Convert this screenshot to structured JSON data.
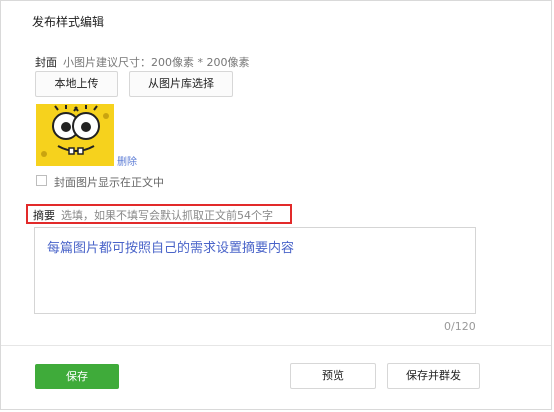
{
  "header": {
    "title": "发布样式编辑"
  },
  "cover": {
    "label": "封面",
    "hint": "小图片建议尺寸：200像素 * 200像素",
    "upload_local_label": "本地上传",
    "choose_from_library_label": "从图片库选择",
    "delete_label": "删除",
    "show_in_body_label": "封面图片显示在正文中",
    "show_in_body_checked": false
  },
  "summary": {
    "label": "摘要",
    "hint": "选填，如果不填写会默认抓取正文前54个字",
    "value": "每篇图片都可按照自己的需求设置摘要内容",
    "counter": "0/120"
  },
  "footer": {
    "save_label": "保存",
    "preview_label": "预览",
    "save_and_send_label": "保存并群发"
  },
  "colors": {
    "primary_green": "#3fab3a",
    "highlight_red": "#e22a2a",
    "link_blue": "#5b7bd5",
    "thumbnail_yellow": "#f6d21d"
  }
}
